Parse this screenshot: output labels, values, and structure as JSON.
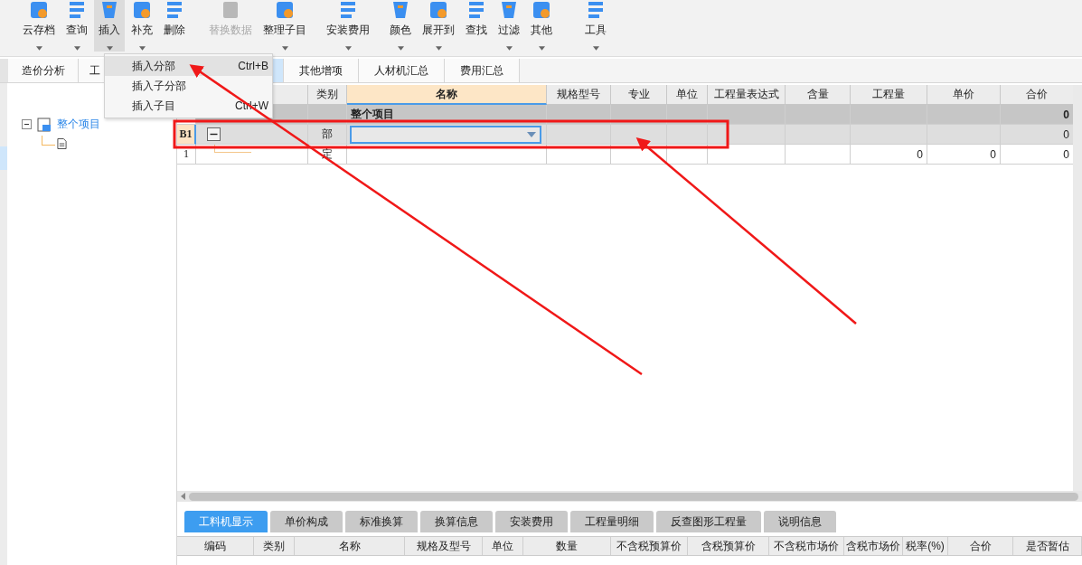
{
  "toolbar": [
    {
      "label": "云存档",
      "dropdown": true,
      "pressed": false,
      "disabled": false
    },
    {
      "label": "查询",
      "dropdown": true,
      "pressed": false,
      "disabled": false
    },
    {
      "label": "插入",
      "dropdown": true,
      "pressed": true,
      "disabled": false
    },
    {
      "label": "补充",
      "dropdown": true,
      "pressed": false,
      "disabled": false
    },
    {
      "label": "删除",
      "dropdown": false,
      "pressed": false,
      "disabled": false
    },
    {
      "label": "替换数据",
      "dropdown": false,
      "pressed": false,
      "disabled": true
    },
    {
      "label": "整理子目",
      "dropdown": true,
      "pressed": false,
      "disabled": false
    },
    {
      "label": "安装费用",
      "dropdown": true,
      "pressed": false,
      "disabled": false
    },
    {
      "label": "颜色",
      "dropdown": true,
      "pressed": false,
      "disabled": false
    },
    {
      "label": "展开到",
      "dropdown": true,
      "pressed": false,
      "disabled": false
    },
    {
      "label": "查找",
      "dropdown": false,
      "pressed": false,
      "disabled": false
    },
    {
      "label": "过滤",
      "dropdown": true,
      "pressed": false,
      "disabled": false
    },
    {
      "label": "其他",
      "dropdown": true,
      "pressed": false,
      "disabled": false
    },
    {
      "label": "工具",
      "dropdown": true,
      "pressed": false,
      "disabled": false
    }
  ],
  "dropdown_menu": {
    "items": [
      {
        "label": "插入分部",
        "shortcut": "Ctrl+B",
        "selected": true
      },
      {
        "label": "插入子分部",
        "selected": false
      },
      {
        "label": "插入子目",
        "shortcut": "Ctrl+W",
        "selected": false
      }
    ]
  },
  "tabs": [
    {
      "label": "造价分析",
      "selected": false
    },
    {
      "label": "工",
      "selected": false
    },
    {
      "selected": true
    },
    {
      "label": "其他增项",
      "selected": false
    },
    {
      "label": "人材机汇总",
      "selected": false
    },
    {
      "label": "费用汇总",
      "selected": false
    }
  ],
  "project_tree": {
    "label": "整个项目",
    "expanded": true,
    "children": [
      {
        "kind": "document"
      }
    ]
  },
  "grid": {
    "columns": [
      {
        "kind": "number"
      },
      {
        "kind": "code"
      },
      {
        "label": "类别",
        "kind": "category"
      },
      {
        "label": "名称",
        "kind": "name"
      },
      {
        "label": "规格型号",
        "kind": "spec"
      },
      {
        "label": "专业",
        "kind": "trade"
      },
      {
        "label": "单位",
        "kind": "unit"
      },
      {
        "label": "工程量表达式",
        "kind": "expression"
      },
      {
        "label": "含量",
        "kind": "content"
      },
      {
        "label": "工程量",
        "kind": "quantity"
      },
      {
        "label": "单价",
        "kind": "unit_price"
      },
      {
        "label": "合价",
        "kind": "total"
      }
    ],
    "rows": [
      {
        "kind": "project",
        "name": "整个项目",
        "total": "0"
      },
      {
        "kind": "section",
        "number": "B1",
        "expanded": true,
        "category": "部",
        "editing": true,
        "total": "0"
      },
      {
        "kind": "item",
        "number": "1",
        "category": "定",
        "quantity": "0",
        "unit_price": "0",
        "total": "0"
      }
    ]
  },
  "detail_tabs": [
    {
      "label": "工料机显示",
      "selected": true
    },
    {
      "label": "单价构成",
      "selected": false
    },
    {
      "label": "标准换算",
      "selected": false
    },
    {
      "label": "换算信息",
      "selected": false
    },
    {
      "label": "安装费用",
      "selected": false
    },
    {
      "label": "工程量明细",
      "selected": false
    },
    {
      "label": "反查图形工程量",
      "selected": false
    },
    {
      "label": "说明信息",
      "selected": false
    }
  ],
  "detail_columns": [
    "编码",
    "类别",
    "名称",
    "规格及型号",
    "单位",
    "数量",
    "不含税预算价",
    "含税预算价",
    "不含税市场价",
    "含税市场价",
    "税率(%)",
    "合价",
    "是否暂估"
  ]
}
